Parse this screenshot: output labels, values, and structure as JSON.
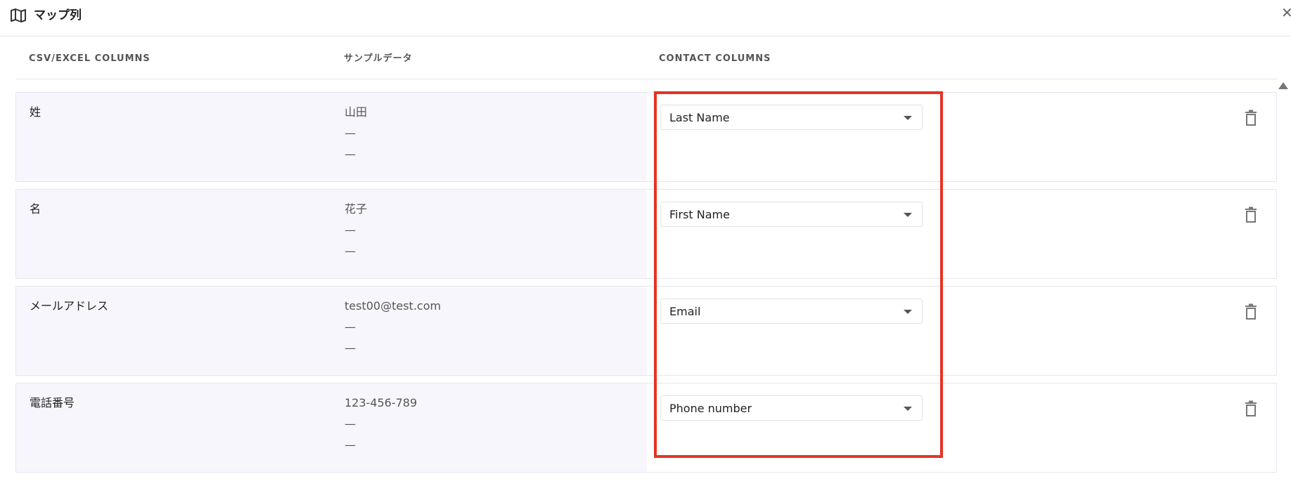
{
  "header": {
    "title": "マップ列",
    "icon": "map-icon",
    "close_icon": "close-icon",
    "close_glyph": "✕"
  },
  "columns": {
    "csv": "CSV/EXCEL COLUMNS",
    "sample": "サンプルデータ",
    "contact": "CONTACT COLUMNS"
  },
  "rows": [
    {
      "csv_name": "姓",
      "samples": [
        "山田",
        "—",
        "—"
      ],
      "contact_column": "Last Name"
    },
    {
      "csv_name": "名",
      "samples": [
        "花子",
        "—",
        "—"
      ],
      "contact_column": "First Name"
    },
    {
      "csv_name": "メールアドレス",
      "samples": [
        "test00@test.com",
        "—",
        "—"
      ],
      "contact_column": "Email"
    },
    {
      "csv_name": "電話番号",
      "samples": [
        "123-456-789",
        "—",
        "—"
      ],
      "contact_column": "Phone number"
    }
  ],
  "colors": {
    "highlight": "#e63323",
    "row_left_bg": "#f8f6fd"
  }
}
